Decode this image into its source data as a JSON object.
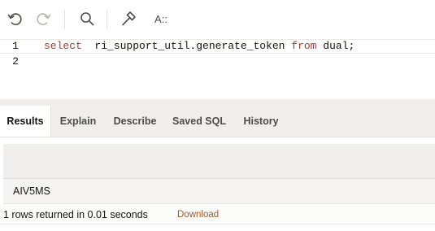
{
  "toolbar": {
    "icons": [
      "undo-icon",
      "redo-icon",
      "search-icon",
      "hammer-icon",
      "format-icon"
    ],
    "format_label": "A::"
  },
  "editor": {
    "lines": [
      {
        "number": "1",
        "keyword1": "select",
        "body": "  ri_support_util.generate_token ",
        "keyword2": "from",
        "tail": " dual;"
      },
      {
        "number": "2"
      }
    ]
  },
  "tabs": [
    {
      "label": "Results",
      "selected": true
    },
    {
      "label": "Explain"
    },
    {
      "label": "Describe"
    },
    {
      "label": "Saved SQL"
    },
    {
      "label": "History"
    }
  ],
  "results": {
    "column_header": "",
    "rows": [
      [
        "AIV5MS"
      ]
    ],
    "status": "1 rows returned in 0.01 seconds",
    "download_label": "Download"
  },
  "colors": {
    "keyword": "#a9392e",
    "download_link": "#a0581f",
    "tab_bar": "#f1efed"
  }
}
